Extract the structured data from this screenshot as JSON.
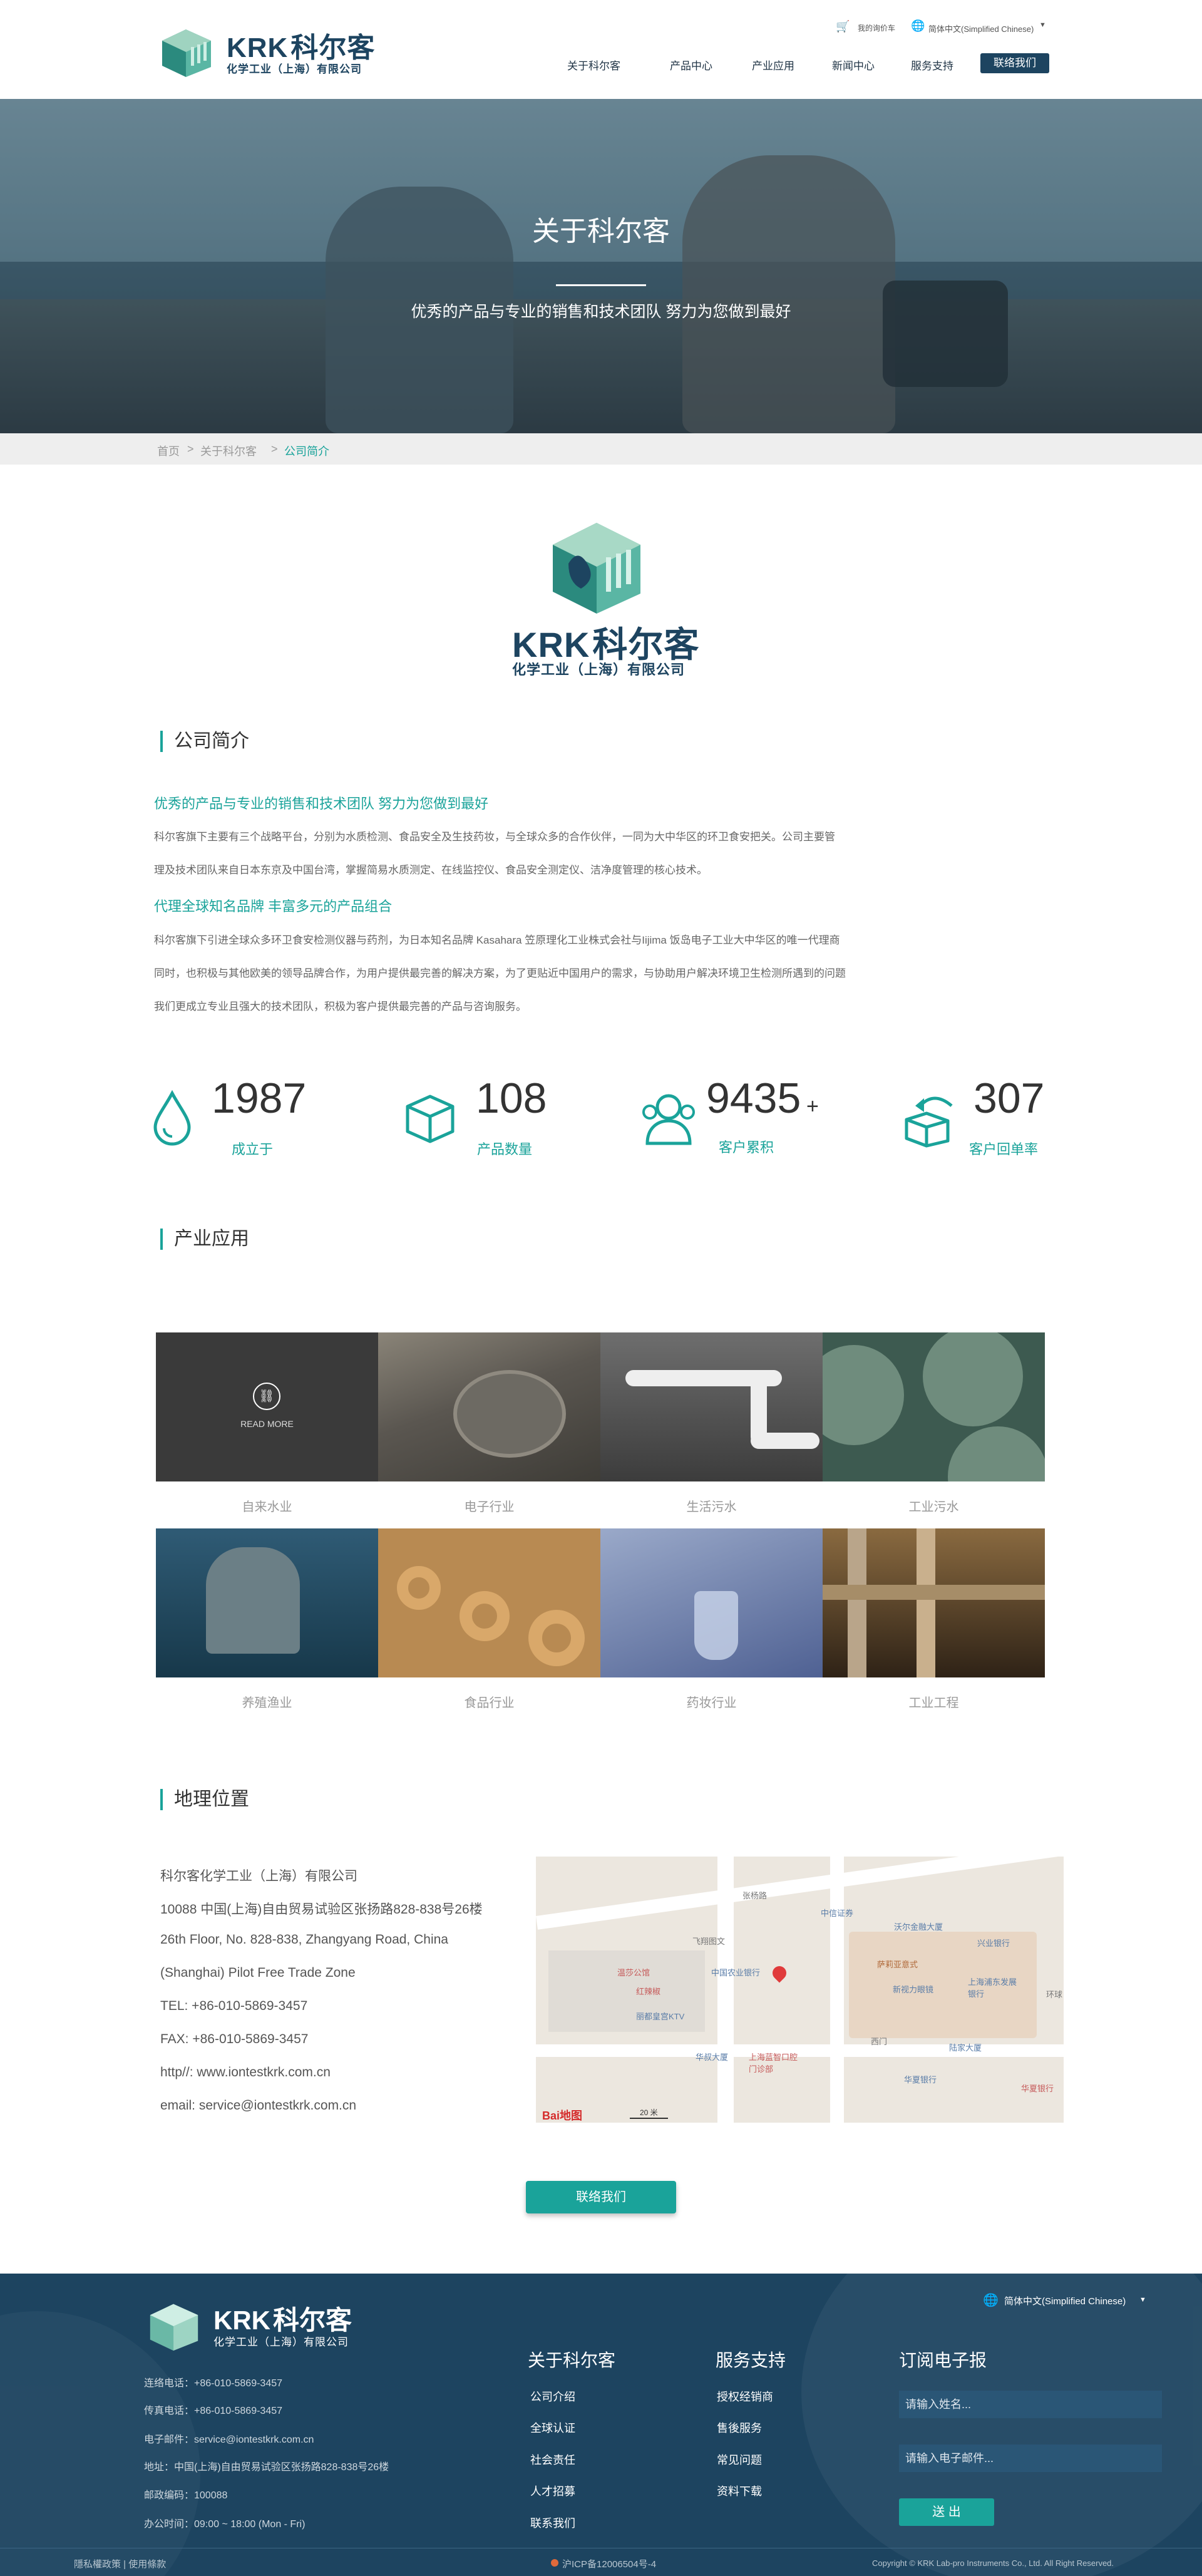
{
  "header": {
    "logo_brand": "KRK",
    "logo_cn": "科尔客",
    "logo_company": "化学工业（上海）有限公司",
    "cart_label": "我的询价车",
    "language": "简体中文(Simplified Chinese)",
    "nav": [
      "关于科尔客",
      "产品中心",
      "产业应用",
      "新闻中心",
      "服务支持"
    ],
    "cta": "联络我们"
  },
  "hero": {
    "title": "关于科尔客",
    "subtitle": "优秀的产品与专业的销售和技术团队 努力为您做到最好"
  },
  "breadcrumb": {
    "home": "首页",
    "sep": ">",
    "level1": "关于科尔客",
    "current": "公司简介"
  },
  "center_logo": {
    "brand": "KRK",
    "cn": "科尔客",
    "company": "化学工业（上海）有限公司"
  },
  "intro": {
    "heading": "公司简介",
    "sub1": "优秀的产品与专业的销售和技术团队 努力为您做到最好",
    "para1_line1": "科尔客旗下主要有三个战略平台，分别为水质检测、食品安全及生技药妆，与全球众多的合作伙伴，一同为大中华区的环卫食安把关。公司主要管",
    "para1_line2": "理及技术团队来自日本东京及中国台湾，掌握简易水质测定、在线监控仪、食品安全测定仪、洁净度管理的核心技术。",
    "sub2": "代理全球知名品牌 丰富多元的产品组合",
    "para2_line1": "科尔客旗下引进全球众多环卫食安检测仪器与药剂，为日本知名品牌 Kasahara 笠原理化工业株式会社与Iijima 饭岛电子工业大中华区的唯一代理商",
    "para2_line2": "同时，也积极与其他欧美的领导品牌合作，为用户提供最完善的解决方案，为了更贴近中国用户的需求，与协助用户解决环境卫生检测所遇到的问题",
    "para2_line3": "我们更成立专业且强大的技术团队，积极为客户提供最完善的产品与咨询服务。"
  },
  "stats": [
    {
      "value": "1987",
      "suffix": "",
      "label": "成立于",
      "icon": "water-drop-icon"
    },
    {
      "value": "108",
      "suffix": "",
      "label": "产品数量",
      "icon": "box-icon"
    },
    {
      "value": "9435",
      "suffix": "+",
      "label": "客户累积",
      "icon": "users-icon"
    },
    {
      "value": "307",
      "suffix": "",
      "label": "客户回单率",
      "icon": "return-box-icon"
    }
  ],
  "industry": {
    "heading": "产业应用",
    "read_more": "READ MORE",
    "tiles": [
      {
        "label": "自来水业"
      },
      {
        "label": "电子行业"
      },
      {
        "label": "生活污水"
      },
      {
        "label": "工业污水"
      },
      {
        "label": "养殖渔业"
      },
      {
        "label": "食品行业"
      },
      {
        "label": "药妆行业"
      },
      {
        "label": "工业工程"
      }
    ]
  },
  "location": {
    "heading": "地理位置",
    "lines": [
      "科尔客化学工业（上海）有限公司",
      "10088 中国(上海)自由贸易试验区张扬路828-838号26楼",
      "26th Floor, No. 828-838, Zhangyang Road, China",
      "(Shanghai) Pilot Free Trade Zone",
      "TEL: +86-010-5869-3457",
      "FAX: +86-010-5869-3457",
      "http//: www.iontestkrk.com.cn",
      "email: service@iontestkrk.com.cn"
    ],
    "map_labels": {
      "road": "张杨路",
      "poi1": "中信证券",
      "poi2": "沃尔金融大厦",
      "poi3": "兴业银行",
      "poi4": "萨莉亚意式",
      "poi5": "新视力眼镜",
      "poi6": "上海浦东发展银行",
      "poi7": "飞翔图文",
      "poi8": "温莎公馆",
      "poi9": "中国农业银行",
      "poi10": "红辣椒",
      "poi11": "丽都皇宫KTV",
      "poi12": "华叔大厦",
      "poi13": "上海蓝智口腔门诊部",
      "poi14": "西门",
      "poi15": "陆家大厦",
      "poi16": "华夏银行",
      "poi17": "华夏银行",
      "poi18": "环球",
      "baidu": "Bai地图",
      "scale": "20 米"
    },
    "contact_button": "联络我们"
  },
  "footer": {
    "brand": "KRK",
    "cn": "科尔客",
    "company": "化学工业（上海）有限公司",
    "language": "简体中文(Simplified Chinese)",
    "info": [
      "连络电话：+86-010-5869-3457",
      "传真电话：+86-010-5869-3457",
      "电子邮件：service@iontestkrk.com.cn",
      "地址：中国(上海)自由贸易试验区张扬路828-838号26楼",
      "邮政编码：100088",
      "办公时间：09:00 ~ 18:00 (Mon - Fri)"
    ],
    "col1_title": "关于科尔客",
    "col1": [
      "公司介绍",
      "全球认证",
      "社会责任",
      "人才招募",
      "联系我们"
    ],
    "col2_title": "服务支持",
    "col2": [
      "授权经销商",
      "售後服务",
      "常见问题",
      "资料下载"
    ],
    "col3_title": "订阅电子报",
    "name_placeholder": "请输入姓名...",
    "email_placeholder": "请输入电子邮件...",
    "submit": "送 出",
    "privacy": "隱私權政策 | 使用條款",
    "icp": "沪ICP备12006504号-4",
    "copyright": "Copyright © KRK Lab-pro Instruments Co., Ltd. All Right Reserved."
  }
}
